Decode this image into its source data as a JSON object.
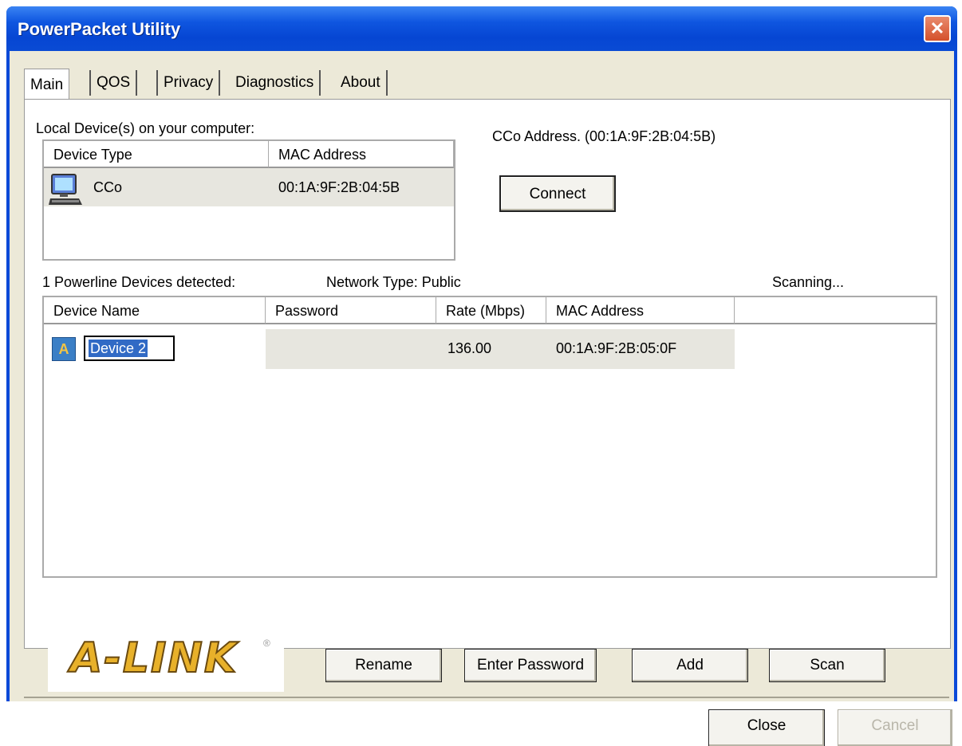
{
  "window": {
    "title": "PowerPacket Utility",
    "close_glyph": "✕"
  },
  "tabs": [
    {
      "label": "Main",
      "active": true
    },
    {
      "label": "QOS"
    },
    {
      "label": "Privacy"
    },
    {
      "label": "Diagnostics"
    },
    {
      "label": "About"
    }
  ],
  "local": {
    "heading": "Local Device(s) on your computer:",
    "columns": [
      "Device Type",
      "MAC Address"
    ],
    "rows": [
      {
        "icon": "computer-icon",
        "type": "CCo",
        "mac": "00:1A:9F:2B:04:5B"
      }
    ],
    "cco_address": "CCo Address. (00:1A:9F:2B:04:5B)",
    "connect_label": "Connect"
  },
  "powerline": {
    "detected": "1 Powerline Devices detected:",
    "network_type": "Network Type: Public",
    "status": "Scanning...",
    "columns": [
      "Device Name",
      "Password",
      "Rate (Mbps)",
      "MAC Address"
    ],
    "rows": [
      {
        "icon": "device-a-icon",
        "icon_letter": "A",
        "name": "Device 2",
        "password": "",
        "rate": "136.00",
        "mac": "00:1A:9F:2B:05:0F"
      }
    ]
  },
  "logo": {
    "text": "A-LINK",
    "reg": "®"
  },
  "actions": {
    "rename": "Rename",
    "enter_password": "Enter Password",
    "add": "Add",
    "scan": "Scan"
  },
  "footer": {
    "close": "Close",
    "cancel": "Cancel"
  }
}
